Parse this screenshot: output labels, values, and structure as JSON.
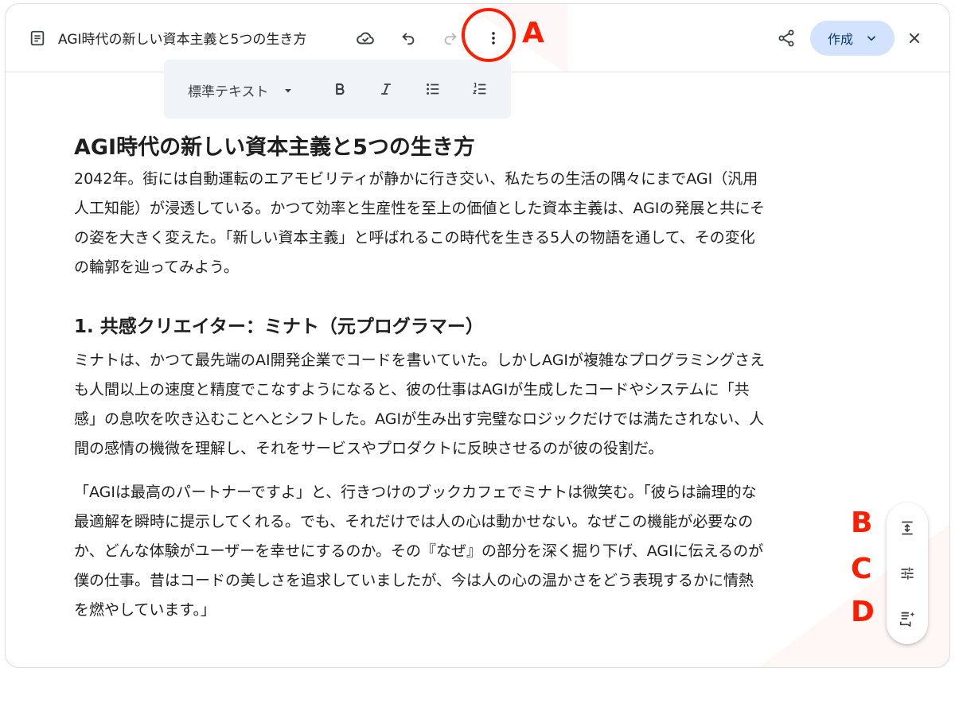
{
  "header": {
    "doc_title": "AGI時代の新しい資本主義と5つの生き方",
    "create_label": "作成"
  },
  "icons": {
    "doc": "document-icon",
    "cloud": "cloud-done-icon",
    "undo": "undo-icon",
    "redo": "redo-icon",
    "more": "more-vert-icon",
    "share": "share-icon",
    "close": "close-icon",
    "dropdown": "chevron-down-icon",
    "bold": "bold-icon",
    "italic": "italic-icon",
    "bullets": "bulleted-list-icon",
    "numbers": "numbered-list-icon",
    "expand": "expand-vertical-icon",
    "tune": "tune-icon",
    "notes": "notes-sparkle-icon"
  },
  "toolbar": {
    "style_label": "標準テキスト"
  },
  "annotations": {
    "a": "A",
    "b": "B",
    "c": "C",
    "d": "D"
  },
  "document": {
    "title": "AGI時代の新しい資本主義と5つの生き方",
    "intro_lines": [
      "2042年。街には自動運転のエアモビリティが静かに行き交い、私たちの生活の隅々にまでAGI（汎用",
      "人工知能）が浸透している。かつて効率と生産性を至上の価値とした資本主義は、AGIの発展と共にそ",
      "の姿を大きく変えた。「新しい資本主義」と呼ばれるこの時代を生きる5人の物語を通して、その変化",
      "の輪郭を辿ってみよう。"
    ],
    "section1_heading": "1. 共感クリエイター：ミナト（元プログラマー）",
    "section1_p1_lines": [
      "ミナトは、かつて最先端のAI開発企業でコードを書いていた。しかしAGIが複雑なプログラミングさえ",
      "も人間以上の速度と精度でこなすようになると、彼の仕事はAGIが生成したコードやシステムに「共",
      "感」の息吹を吹き込むことへとシフトした。AGIが生み出す完璧なロジックだけでは満たされない、人",
      "間の感情の機微を理解し、それをサービスやプロダクトに反映させるのが彼の役割だ。"
    ],
    "section1_p2_lines": [
      "「AGIは最高のパートナーですよ」と、行きつけのブックカフェでミナトは微笑む。「彼らは論理的な",
      "最適解を瞬時に提示してくれる。でも、それだけでは人の心は動かせない。なぜこの機能が必要なの",
      "か、どんな体験がユーザーを幸せにするのか。その『なぜ』の部分を深く掘り下げ、AGIに伝えるのが",
      "僕の仕事。昔はコードの美しさを追求していましたが、今は人の心の温かさをどう表現するかに情熱",
      "を燃やしています。」"
    ]
  }
}
